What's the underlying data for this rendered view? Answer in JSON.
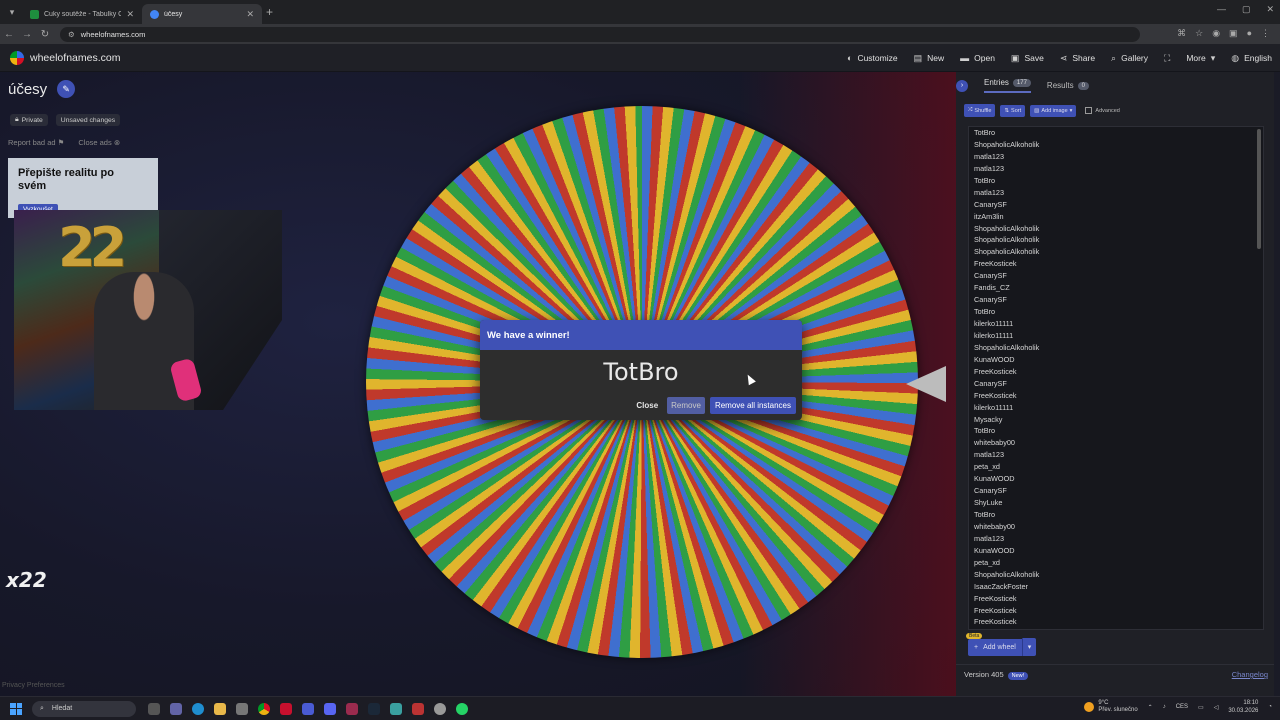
{
  "browser": {
    "tabs": [
      {
        "title": "Čuky soutěže - Tabulky Google",
        "color": "#1e8e3e"
      },
      {
        "title": "účesy",
        "color": "#4285f4"
      }
    ],
    "url": "wheelofnames.com"
  },
  "site": {
    "logo_text": "wheelofnames.com",
    "menu": [
      {
        "icon": "palette-icon",
        "label": "Customize"
      },
      {
        "icon": "new-file-icon",
        "label": "New"
      },
      {
        "icon": "folder-icon",
        "label": "Open"
      },
      {
        "icon": "save-icon",
        "label": "Save"
      },
      {
        "icon": "share-icon",
        "label": "Share"
      },
      {
        "icon": "search-icon",
        "label": "Gallery"
      },
      {
        "icon": "fullscreen-icon",
        "label": ""
      },
      {
        "icon": "chevron-down-icon",
        "label": "More"
      },
      {
        "icon": "globe-icon",
        "label": "English"
      }
    ]
  },
  "wheel": {
    "title": "účesy",
    "chip_private": "Private",
    "chip_unsaved": "Unsaved changes",
    "report_ad": "Report bad ad",
    "close_ads": "Close ads",
    "colors": [
      "#3f6fcf",
      "#c0392b",
      "#e0b52d",
      "#2f9e44"
    ]
  },
  "ad": {
    "headline": "Přepište realitu po svém",
    "button": "Vyzkoušet"
  },
  "overlay": {
    "balloon": "22",
    "logo": "x22"
  },
  "dialog": {
    "header": "We have a winner!",
    "winner": "TotBro",
    "close": "Close",
    "remove": "Remove",
    "remove_all": "Remove all instances"
  },
  "sidebar": {
    "entries_tab": "Entries",
    "entries_count": "177",
    "results_tab": "Results",
    "results_count": "0",
    "shuffle": "Shuffle",
    "sort": "Sort",
    "add_image": "Add image",
    "advanced": "Advanced",
    "entries": [
      "TotBro",
      "ShopaholicAlkoholik",
      "matla123",
      "matla123",
      "TotBro",
      "matla123",
      "CanarySF",
      "itzAm3lin",
      "ShopaholicAlkoholik",
      "ShopaholicAlkoholik",
      "ShopaholicAlkoholik",
      "FreeKosticek",
      "CanarySF",
      "Fandis_CZ",
      "CanarySF",
      "TotBro",
      "kilerko11111",
      "kilerko11111",
      "ShopaholicAlkoholik",
      "KunaWOOD",
      "FreeKosticek",
      "CanarySF",
      "FreeKosticek",
      "kilerko11111",
      "Mysacky",
      "TotBro",
      "whitebaby00",
      "matla123",
      "peta_xd",
      "KunaWOOD",
      "CanarySF",
      "ShyLuke",
      "TotBro",
      "whitebaby00",
      "matla123",
      "KunaWOOD",
      "peta_xd",
      "ShopaholicAlkoholik",
      "IsaacZackFoster",
      "FreeKosticek",
      "FreeKosticek",
      "FreeKosticek"
    ],
    "beta": "Beta",
    "add_wheel": "Add wheel",
    "version": "Version 405",
    "new_badge": "New!",
    "changelog": "Changelog"
  },
  "privacy": "Privacy Preferences",
  "taskbar": {
    "search": "Hledat",
    "weather_temp": "9°C",
    "weather_desc": "Přev. slunečno",
    "lang": "CES",
    "time": "18:10",
    "date": "30.03.2026"
  }
}
